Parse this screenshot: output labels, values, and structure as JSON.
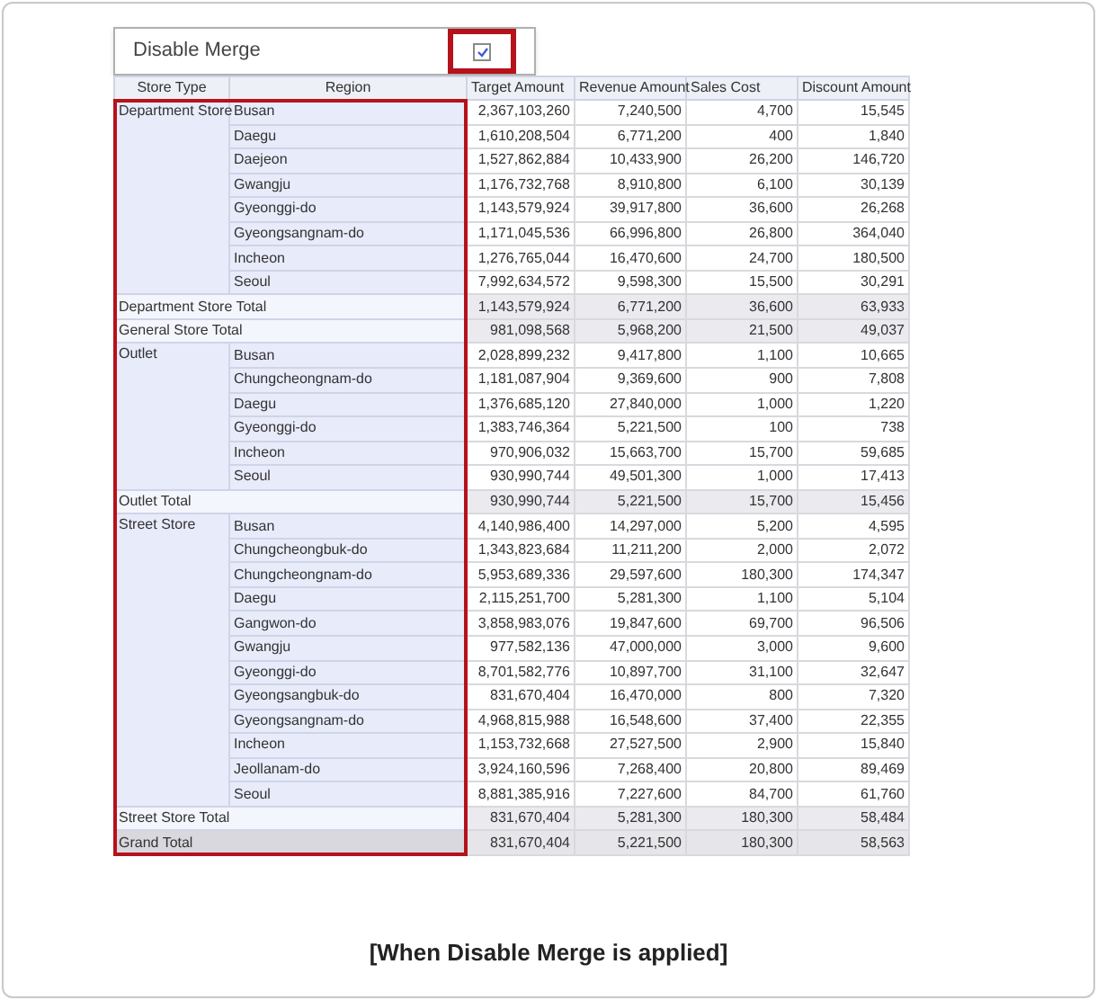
{
  "option": {
    "label": "Disable Merge",
    "checked": true
  },
  "table": {
    "columns": [
      "Store Type",
      "Region",
      "Target Amount",
      "Revenue Amount",
      "Sales Cost",
      "Discount Amount"
    ],
    "rows": [
      {
        "kind": "detail",
        "store_type": "Department Store",
        "region": "Busan",
        "values": [
          "2,367,103,260",
          "7,240,500",
          "4,700",
          "15,545"
        ]
      },
      {
        "kind": "detail",
        "region": "Daegu",
        "values": [
          "1,610,208,504",
          "6,771,200",
          "400",
          "1,840"
        ]
      },
      {
        "kind": "detail",
        "region": "Daejeon",
        "values": [
          "1,527,862,884",
          "10,433,900",
          "26,200",
          "146,720"
        ]
      },
      {
        "kind": "detail",
        "region": "Gwangju",
        "values": [
          "1,176,732,768",
          "8,910,800",
          "6,100",
          "30,139"
        ]
      },
      {
        "kind": "detail",
        "region": "Gyeonggi-do",
        "values": [
          "1,143,579,924",
          "39,917,800",
          "36,600",
          "26,268"
        ]
      },
      {
        "kind": "detail",
        "region": "Gyeongsangnam-do",
        "values": [
          "1,171,045,536",
          "66,996,800",
          "26,800",
          "364,040"
        ]
      },
      {
        "kind": "detail",
        "region": "Incheon",
        "values": [
          "1,276,765,044",
          "16,470,600",
          "24,700",
          "180,500"
        ]
      },
      {
        "kind": "detail",
        "region": "Seoul",
        "values": [
          "7,992,634,572",
          "9,598,300",
          "15,500",
          "30,291"
        ]
      },
      {
        "kind": "subtotal",
        "label": "Department Store Total",
        "values": [
          "1,143,579,924",
          "6,771,200",
          "36,600",
          "63,933"
        ]
      },
      {
        "kind": "subtotal",
        "label": "General Store Total",
        "values": [
          "981,098,568",
          "5,968,200",
          "21,500",
          "49,037"
        ]
      },
      {
        "kind": "detail",
        "store_type": "Outlet",
        "region": "Busan",
        "values": [
          "2,028,899,232",
          "9,417,800",
          "1,100",
          "10,665"
        ]
      },
      {
        "kind": "detail",
        "region": "Chungcheongnam-do",
        "values": [
          "1,181,087,904",
          "9,369,600",
          "900",
          "7,808"
        ]
      },
      {
        "kind": "detail",
        "region": "Daegu",
        "values": [
          "1,376,685,120",
          "27,840,000",
          "1,000",
          "1,220"
        ]
      },
      {
        "kind": "detail",
        "region": "Gyeonggi-do",
        "values": [
          "1,383,746,364",
          "5,221,500",
          "100",
          "738"
        ]
      },
      {
        "kind": "detail",
        "region": "Incheon",
        "values": [
          "970,906,032",
          "15,663,700",
          "15,700",
          "59,685"
        ]
      },
      {
        "kind": "detail",
        "region": "Seoul",
        "values": [
          "930,990,744",
          "49,501,300",
          "1,000",
          "17,413"
        ]
      },
      {
        "kind": "subtotal",
        "label": "Outlet Total",
        "values": [
          "930,990,744",
          "5,221,500",
          "15,700",
          "15,456"
        ]
      },
      {
        "kind": "detail",
        "store_type": "Street Store",
        "region": "Busan",
        "values": [
          "4,140,986,400",
          "14,297,000",
          "5,200",
          "4,595"
        ]
      },
      {
        "kind": "detail",
        "region": "Chungcheongbuk-do",
        "values": [
          "1,343,823,684",
          "11,211,200",
          "2,000",
          "2,072"
        ]
      },
      {
        "kind": "detail",
        "region": "Chungcheongnam-do",
        "values": [
          "5,953,689,336",
          "29,597,600",
          "180,300",
          "174,347"
        ]
      },
      {
        "kind": "detail",
        "region": "Daegu",
        "values": [
          "2,115,251,700",
          "5,281,300",
          "1,100",
          "5,104"
        ]
      },
      {
        "kind": "detail",
        "region": "Gangwon-do",
        "values": [
          "3,858,983,076",
          "19,847,600",
          "69,700",
          "96,506"
        ]
      },
      {
        "kind": "detail",
        "region": "Gwangju",
        "values": [
          "977,582,136",
          "47,000,000",
          "3,000",
          "9,600"
        ]
      },
      {
        "kind": "detail",
        "region": "Gyeonggi-do",
        "values": [
          "8,701,582,776",
          "10,897,700",
          "31,100",
          "32,647"
        ]
      },
      {
        "kind": "detail",
        "region": "Gyeongsangbuk-do",
        "values": [
          "831,670,404",
          "16,470,000",
          "800",
          "7,320"
        ]
      },
      {
        "kind": "detail",
        "region": "Gyeongsangnam-do",
        "values": [
          "4,968,815,988",
          "16,548,600",
          "37,400",
          "22,355"
        ]
      },
      {
        "kind": "detail",
        "region": "Incheon",
        "values": [
          "1,153,732,668",
          "27,527,500",
          "2,900",
          "15,840"
        ]
      },
      {
        "kind": "detail",
        "region": "Jeollanam-do",
        "values": [
          "3,924,160,596",
          "7,268,400",
          "20,800",
          "89,469"
        ]
      },
      {
        "kind": "detail",
        "region": "Seoul",
        "values": [
          "8,881,385,916",
          "7,227,600",
          "84,700",
          "61,760"
        ]
      },
      {
        "kind": "subtotal",
        "label": "Street Store Total",
        "values": [
          "831,670,404",
          "5,281,300",
          "180,300",
          "58,484"
        ]
      },
      {
        "kind": "grand_total",
        "label": "Grand Total",
        "values": [
          "831,670,404",
          "5,221,500",
          "180,300",
          "58,563"
        ]
      }
    ]
  },
  "caption": "[When Disable Merge is applied]"
}
